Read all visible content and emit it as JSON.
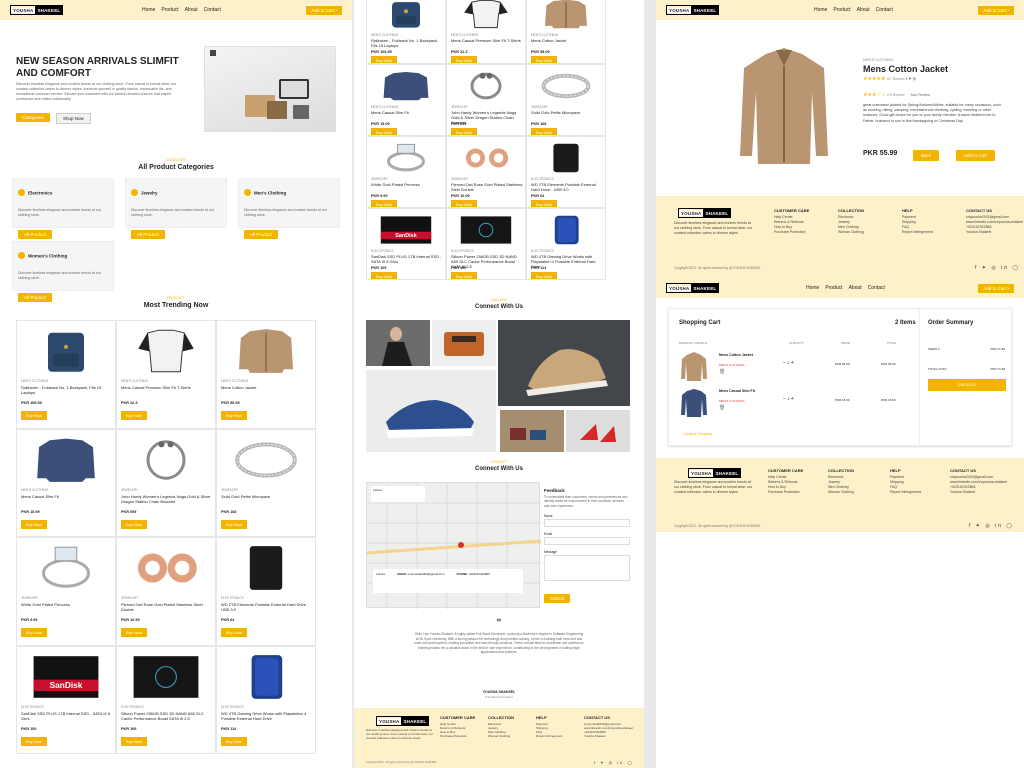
{
  "brand": {
    "left": "YOUSHA",
    "right": "SHAKEEL"
  },
  "nav": {
    "links": [
      "Home",
      "Product",
      "About",
      "Contact"
    ],
    "cart": "Add to Cart •"
  },
  "hero": {
    "title": "NEW SEASON ARRIVALS SLIMFIT AND COMFORT",
    "text": "Discover timeless elegance and modern trends at our clothing store. From casual to formal wear, our curated collection caters to diverse styles. Immerse yourself in quality fabrics, impeccable fits, and exceptional customer service. Elevate your wardrobe with our fashion-forward choices that inspire confidence and reflect individuality.",
    "btn1": "Categories",
    "btn2": "Shop Now"
  },
  "categories": {
    "eyebrow": "CATEGORY",
    "title": "All Product Categories",
    "desc": "Discover timeless elegance and modern trends at our clothing store.",
    "btn": "All Product",
    "items": [
      "Electronics",
      "Jewelry",
      "Men's Clothing",
      "Women's Clothing"
    ]
  },
  "trending": {
    "eyebrow": "PRODUCT",
    "title": "Most Trending Now",
    "buy": "Buy Now",
    "products": [
      {
        "cat": "MEN'S CLOTHING",
        "name": "Fjallraven - Foldsack No. 1 Backpack, Fits 15 Laptops",
        "price": "PKR 109.95",
        "img": "backpack"
      },
      {
        "cat": "MEN'S CLOTHING",
        "name": "Mens Casual Premium Slim Fit T-Shirts",
        "price": "PKR 22.3",
        "img": "tshirt"
      },
      {
        "cat": "MEN'S CLOTHING",
        "name": "Mens Cotton Jacket",
        "price": "PKR 55.99",
        "img": "jacket"
      },
      {
        "cat": "MEN'S CLOTHING",
        "name": "Mens Casual Slim Fit",
        "price": "PKR 15.99",
        "img": "shirt"
      },
      {
        "cat": "JEWELERY",
        "name": "John Hardy Women's Legends Naga Gold & Silver Dragon Station Chain Bracelet",
        "price": "PKR 695",
        "img": "bracelet"
      },
      {
        "cat": "JEWELERY",
        "name": "Solid Gold Petite Micropave",
        "price": "PKR 168",
        "img": "ring"
      },
      {
        "cat": "JEWELERY",
        "name": "White Gold Plated Princess",
        "price": "PKR 9.99",
        "img": "diamond"
      },
      {
        "cat": "JEWELERY",
        "name": "Pierced Owl Rose Gold Plated Stainless Steel Double",
        "price": "PKR 10.99",
        "img": "plugs"
      },
      {
        "cat": "ELECTRONICS",
        "name": "WD 2TB Elements Portable External Hard Drive - USB 3.0",
        "price": "PKR 64",
        "img": "hdd"
      },
      {
        "cat": "ELECTRONICS",
        "name": "SanDisk SSD PLUS 1TB Internal SSD - SATA III 6 Gb/s",
        "price": "PKR 109",
        "img": "sandisk"
      },
      {
        "cat": "ELECTRONICS",
        "name": "Silicon Power 256GB SSD 3D NAND A55 SLC Cache Performance Boost SATA III 2.5",
        "price": "PKR 109",
        "img": "sp"
      },
      {
        "cat": "ELECTRONICS",
        "name": "WD 4TB Gaming Drive Works with Playstation 4 Portable External Hard Drive",
        "price": "PKR 114",
        "img": "wd4"
      }
    ]
  },
  "connect": {
    "eyebrow": "GALLERY",
    "title": "Connect With Us"
  },
  "contact": {
    "eyebrow": "CONTACT",
    "title": "Connect With Us",
    "feedback_title": "Feedback",
    "feedback_text": "To understand their customers, needs and preferences and identify areas for improvement in their products, services and user experience.",
    "name_label": "Name",
    "email_label": "Email",
    "message_label": "Message",
    "submit": "Submit",
    "map_address": "Lahore",
    "map_email_label": "EMAIL",
    "map_phone_label": "PHONE",
    "map_phone": "+923152322865",
    "map_email": "smyousha2002@gmail.com"
  },
  "testimonial": {
    "quote": "Hello I am Yousha Shakeel. A highly skilled Full Stack Developer, pursuing a Bachelor's degree in Software Engineering at Sir Syed University. With a strong passion for technology and problem-solving, I excel in building both front-end and back-end development, crafting innovative and user-friendly solutions. Thrive commit steal to excellence and continuous learning makes me a valuable asset in the field of user experience, contributing to the development of cutting edge applications and systems.",
    "name": "YOUSHA SHAKEEL",
    "role": "Full Stack Developer"
  },
  "detail": {
    "cat": "MEN'S CLOTHING",
    "title": "Mens Cotton Jacket",
    "reviews": "4.7 Review",
    "reviews2": "2.5 Review",
    "your_review": "Your Review",
    "desc": "great outerwear jackets for Spring/Autumn/Winter, suitable for many occasions, such as working, hiking, camping, mountain/rock climbing, cycling, traveling or other outdoors. Good gift choice for you or your family member. A warm hearted love to Father, husband or son in this thanksgiving or Christmas Day.",
    "price": "PKR 55.99",
    "back": "Back",
    "add": "Add to Cart"
  },
  "footer": {
    "desc": "Discover timeless elegance and modern trends at our clothing store. From casual to formal wear, our curated collection caters to diverse styles.",
    "care": {
      "title": "CUSTOMER CARE",
      "items": [
        "Help Center",
        "Returns & Refunds",
        "How to Buy",
        "Purchase Protection"
      ]
    },
    "coll": {
      "title": "COLLECTION",
      "items": [
        "Electronic",
        "Jewelry",
        "Men Clothing",
        "Woman Clothing"
      ]
    },
    "help": {
      "title": "HELP",
      "items": [
        "Payment",
        "Shipping",
        "FAQ",
        "Report Infringement"
      ]
    },
    "contact": {
      "title": "CONTACT US",
      "items": [
        "smyousha2002@gmail.com",
        "www.linkedin.com/in/yousha-shakeel",
        "+923152322865",
        "Yousha Shakeel"
      ]
    },
    "copyright": "Copyright 2023 - All rights reserved by @YOUSHA SHAKEEL",
    "social": "f ✦ ◎ in ◯"
  },
  "cart": {
    "title": "Shopping Cart",
    "count": "2 Items",
    "col_product": "PRODUCT DETAILS",
    "col_qty": "QUANTITY",
    "col_price": "PRICE",
    "col_total": "TOTAL",
    "items": [
      {
        "name": "Mens Cotton Jacket",
        "cat": "MEN'S CLOTHING",
        "qty": "1",
        "price": "PKR 55.99",
        "total": "PKR 55.99"
      },
      {
        "name": "Mens Casual Slim Fit",
        "cat": "MEN'S CLOTHING",
        "qty": "1",
        "price": "PKR 15.99",
        "total": "PKR 15.99"
      }
    ],
    "continue": "← Continue Shopping",
    "summary_title": "Order Summary",
    "items_label": "ITEMS 2",
    "items_val": "PKR 71.98",
    "total_label": "TOTAL COST",
    "total_val": "PKR 71.98",
    "checkout": "CHECKOUT"
  }
}
